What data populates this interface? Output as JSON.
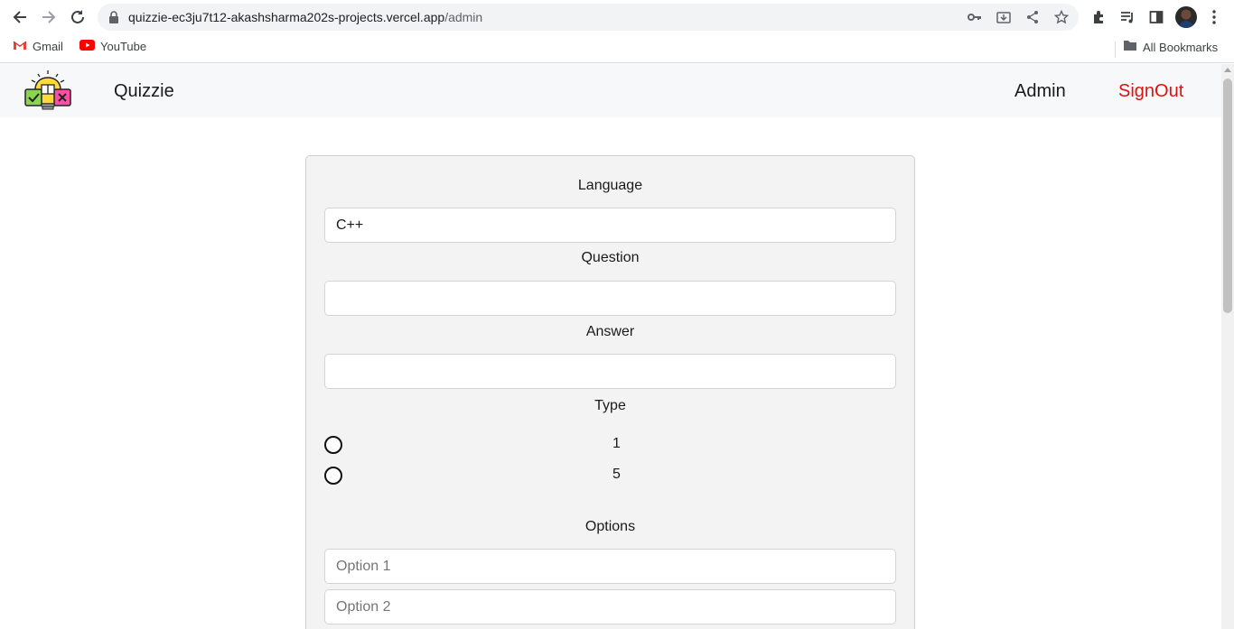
{
  "browser": {
    "url_host": "quizzie-ec3ju7t12-akashsharma202s-projects.vercel.app",
    "url_path": "/admin",
    "bookmarks": [
      {
        "label": "Gmail",
        "icon": "gmail-icon"
      },
      {
        "label": "YouTube",
        "icon": "youtube-icon"
      }
    ],
    "all_bookmarks_label": "All Bookmarks"
  },
  "header": {
    "brand": "Quizzie",
    "nav_admin": "Admin",
    "nav_signout": "SignOut",
    "signout_color": "#e0110f"
  },
  "form": {
    "language_label": "Language",
    "language_value": "C++",
    "question_label": "Question",
    "question_value": "",
    "answer_label": "Answer",
    "answer_value": "",
    "type_label": "Type",
    "type_options": [
      "1",
      "5"
    ],
    "options_label": "Options",
    "option_placeholders": [
      "Option 1",
      "Option 2"
    ]
  }
}
